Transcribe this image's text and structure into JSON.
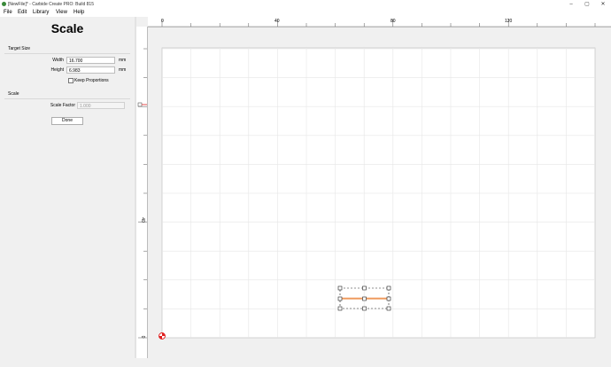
{
  "window": {
    "title": "[NewFile]* - Carbide Create PRO: Build 815",
    "minimize_glyph": "–",
    "maximize_glyph": "▢",
    "close_glyph": "✕"
  },
  "menu": {
    "items": [
      "File",
      "Edit",
      "Library",
      "View",
      "Help"
    ]
  },
  "panel": {
    "title": "Scale",
    "target_size_label": "Target Size",
    "width_label": "Width",
    "width_value": "16.700",
    "width_unit": "mm",
    "height_label": "Height",
    "height_value": "6.983",
    "height_unit": "mm",
    "keep_proportions_label": "Keep Proportions",
    "keep_proportions_checked": false,
    "scale_section_label": "Scale",
    "scale_factor_label": "Scale Factor",
    "scale_factor_value": "1.000",
    "done_label": "Done"
  },
  "canvas": {
    "top_ruler_labels": [
      "0",
      "40",
      "80",
      "120"
    ],
    "left_ruler_labels": [
      "40",
      "0"
    ],
    "grid_color": "#e6e6e6",
    "selection_color": "#e8701a",
    "origin_color": "#e02020"
  }
}
